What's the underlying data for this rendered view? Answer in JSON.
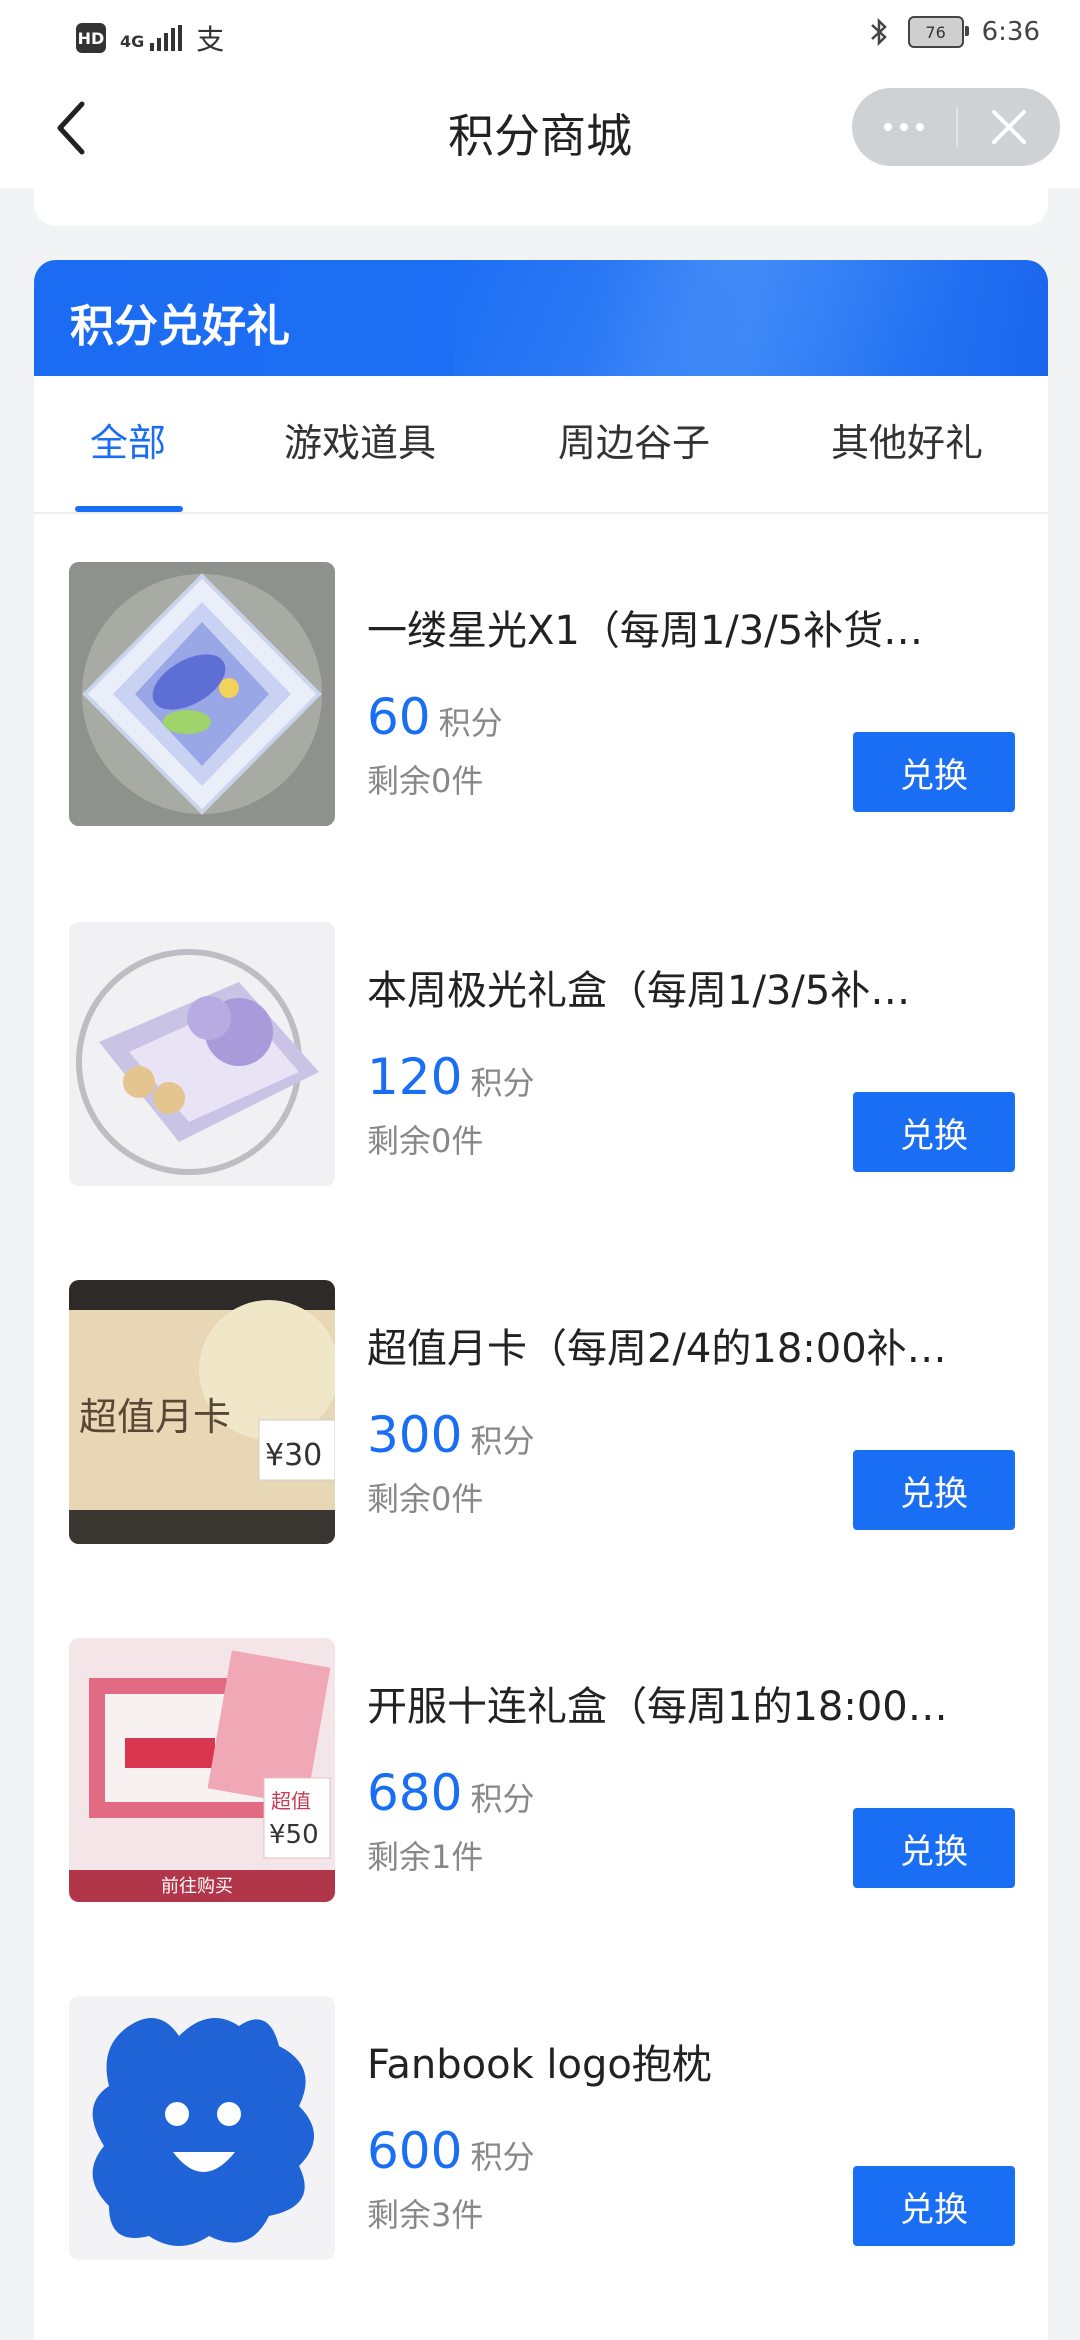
{
  "status_bar": {
    "hd": "HD",
    "network": "4G",
    "pay_glyph": "支",
    "battery": "76",
    "time": "6:36"
  },
  "nav": {
    "title": "积分商城"
  },
  "section": {
    "title": "积分兑好礼"
  },
  "tabs": [
    {
      "label": "全部",
      "active": true
    },
    {
      "label": "游戏道具",
      "active": false
    },
    {
      "label": "周边谷子",
      "active": false
    },
    {
      "label": "其他好礼",
      "active": false
    }
  ],
  "items": [
    {
      "name": "一缕星光X1（每周1/3/5补货…",
      "points": "60",
      "unit": "积分",
      "stock": "剩余0件",
      "button": "兑换"
    },
    {
      "name": "本周极光礼盒（每周1/3/5补…",
      "points": "120",
      "unit": "积分",
      "stock": "剩余0件",
      "button": "兑换"
    },
    {
      "name": "超值月卡（每周2/4的18:00补…",
      "points": "300",
      "unit": "积分",
      "stock": "剩余0件",
      "button": "兑换"
    },
    {
      "name": "开服十连礼盒（每周1的18:00…",
      "points": "680",
      "unit": "积分",
      "stock": "剩余1件",
      "button": "兑换"
    },
    {
      "name": "Fanbook logo抱枕",
      "points": "600",
      "unit": "积分",
      "stock": "剩余3件",
      "button": "兑换"
    }
  ],
  "thumb_text": {
    "card_title": "超值月卡",
    "card_price": "¥30",
    "gift_label": "超值",
    "gift_price": "¥50",
    "gift_footer": "前往购买"
  },
  "colors": {
    "accent": "#1a6ef3",
    "muted": "#888888"
  }
}
